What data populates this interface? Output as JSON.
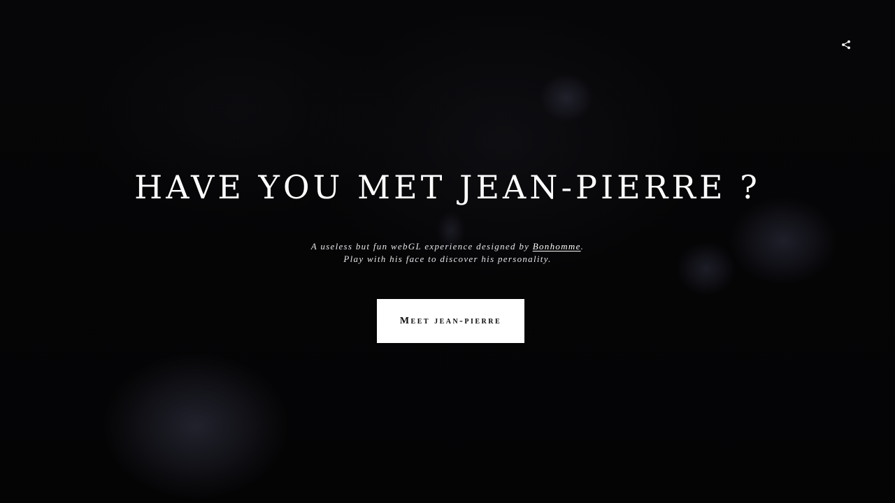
{
  "header": {
    "share_icon": "share-icon"
  },
  "hero": {
    "title": "HAVE YOU MET JEAN-PIERRE ?",
    "subtitle_line1_prefix": "A useless but fun webGL experience designed by ",
    "subtitle_link": "Bonhomme",
    "subtitle_line1_suffix": ".",
    "subtitle_line2": "Play with his face to discover his personality."
  },
  "cta": {
    "label": "Meet jean-pierre"
  },
  "colors": {
    "background": "#050507",
    "text": "#ffffff",
    "button_bg": "#ffffff",
    "button_text": "#0b0b0d"
  }
}
